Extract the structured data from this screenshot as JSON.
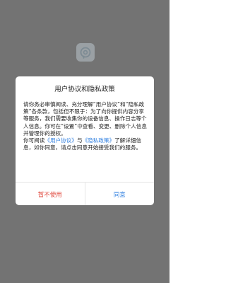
{
  "app": {
    "logo_icon": "app-logo-icon"
  },
  "dialog": {
    "title": "用户协议和隐私政策",
    "paragraph1": "请你务必审慎阅读、充分理解“用户协议”和“隐私政策”各条款，包括但不限于：为了向你提供内容分享等服务，我们需要收集你的设备信息、操作日志等个人信息。你可在“设置”中查看、变更、删除个人信息并管理你的授权。",
    "p2_prefix": "你可阅读",
    "user_agreement_link": "《用户协议》",
    "p2_and": "与",
    "privacy_policy_link": "《隐私政策》",
    "p2_suffix": "了解详细信息，如你同意，请点击同意开始接受我们的服务。",
    "decline_label": "暂不使用",
    "agree_label": "同意"
  },
  "colors": {
    "overlay": "#737373",
    "link": "#2f7fe0",
    "decline": "#e0453a"
  }
}
